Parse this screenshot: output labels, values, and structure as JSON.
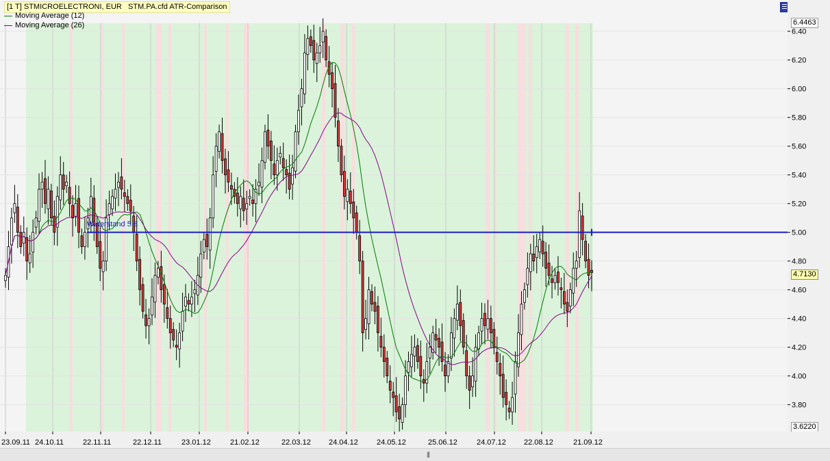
{
  "window": {
    "title": "[1 T] STMICROELECTRONI, EUR   STM.PA.cfd ATR-Comparison"
  },
  "legend": [
    {
      "label": "Moving Average  (12)",
      "color": "#007a00"
    },
    {
      "label": "Moving Average  (26)",
      "color": "#8a008a"
    }
  ],
  "price_labels": {
    "top": "6.4463",
    "bottom": "3.6220",
    "last": "4.7130"
  },
  "annotation": {
    "label": "Widerstand 5 €",
    "level": 5.0,
    "color": "#1a1acc"
  },
  "chart_data": {
    "type": "candlestick",
    "y_ticks": [
      "6.40",
      "6.20",
      "6.00",
      "5.80",
      "5.60",
      "5.40",
      "5.20",
      "5.00",
      "4.80",
      "4.60",
      "4.40",
      "4.20",
      "4.00",
      "3.80"
    ],
    "x_ticks": [
      "23.09.11",
      "24.10.11",
      "22.11.11",
      "22.12.11",
      "23.01.12",
      "21.02.12",
      "22.03.12",
      "24.04.12",
      "24.05.12",
      "25.06.12",
      "24.07.12",
      "22.08.12",
      "21.09.12"
    ],
    "ylim": [
      3.622,
      6.4463
    ],
    "highlight_colors": {
      "green": "#daf3da",
      "red": "#f8dede"
    },
    "close": [
      4.7,
      4.9,
      5.1,
      5.2,
      5.0,
      4.9,
      5.0,
      4.8,
      4.85,
      5.0,
      5.1,
      5.3,
      5.35,
      5.2,
      5.3,
      5.1,
      5.0,
      5.25,
      5.4,
      5.3,
      5.35,
      5.2,
      5.1,
      5.2,
      5.0,
      4.9,
      5.0,
      5.1,
      5.25,
      5.05,
      4.9,
      4.75,
      4.8,
      5.1,
      5.2,
      5.25,
      5.3,
      5.35,
      5.3,
      5.25,
      5.2,
      5.15,
      5.0,
      4.8,
      4.6,
      4.45,
      4.35,
      4.4,
      4.55,
      4.7,
      4.75,
      4.6,
      4.5,
      4.4,
      4.3,
      4.25,
      4.2,
      4.3,
      4.45,
      4.55,
      4.5,
      4.55,
      4.6,
      4.7,
      4.85,
      4.95,
      4.9,
      5.1,
      5.4,
      5.6,
      5.7,
      5.5,
      5.4,
      5.35,
      5.3,
      5.25,
      5.2,
      5.25,
      5.15,
      5.2,
      5.25,
      5.2,
      5.3,
      5.35,
      5.5,
      5.7,
      5.6,
      5.5,
      5.4,
      5.5,
      5.55,
      5.45,
      5.4,
      5.3,
      5.45,
      5.7,
      5.85,
      6.0,
      6.25,
      6.35,
      6.3,
      6.2,
      6.25,
      6.3,
      6.4,
      6.2,
      6.1,
      6.0,
      5.8,
      5.6,
      5.4,
      5.25,
      5.3,
      5.2,
      5.1,
      5.0,
      4.8,
      4.3,
      4.4,
      4.6,
      4.5,
      4.45,
      4.3,
      4.2,
      4.1,
      4.0,
      3.9,
      3.85,
      3.75,
      3.7,
      3.8,
      4.0,
      4.1,
      4.15,
      4.2,
      4.1,
      4.0,
      3.95,
      4.1,
      4.2,
      4.3,
      4.25,
      4.2,
      4.1,
      4.0,
      4.1,
      4.3,
      4.4,
      4.5,
      4.35,
      4.2,
      4.0,
      3.9,
      4.0,
      4.2,
      4.3,
      4.4,
      4.35,
      4.4,
      4.3,
      4.2,
      4.1,
      4.0,
      3.85,
      3.8,
      3.75,
      3.85,
      4.1,
      4.3,
      4.5,
      4.6,
      4.75,
      4.85,
      4.8,
      4.9,
      4.95,
      4.85,
      4.75,
      4.7,
      4.65,
      4.7,
      4.65,
      4.6,
      4.5,
      4.45,
      4.6,
      4.75,
      4.8,
      5.15,
      4.95,
      4.8,
      4.7,
      4.72
    ],
    "ma_periods": [
      12,
      26
    ]
  }
}
